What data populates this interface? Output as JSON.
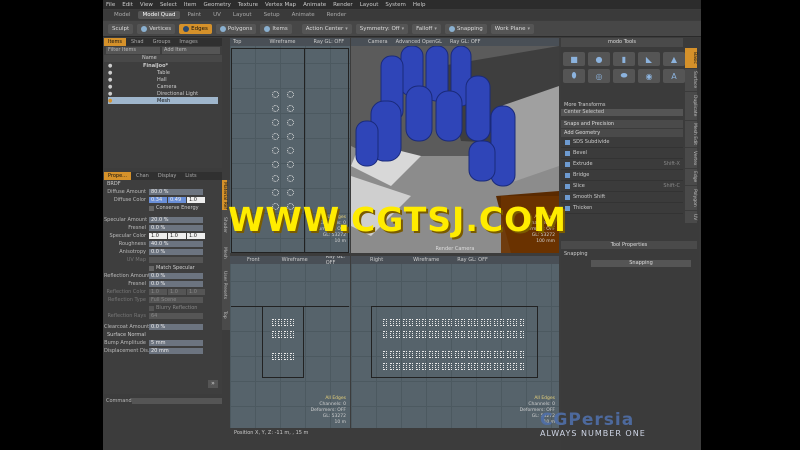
{
  "menu": [
    "File",
    "Edit",
    "View",
    "Select",
    "Item",
    "Geometry",
    "Texture",
    "Vertex Map",
    "Animate",
    "Render",
    "Layout",
    "System",
    "Help"
  ],
  "layout_tabs": [
    {
      "label": "Model",
      "active": false
    },
    {
      "label": "Model Quad",
      "active": true
    },
    {
      "label": "Paint",
      "active": false
    },
    {
      "label": "UV",
      "active": false
    },
    {
      "label": "Layout",
      "active": false
    },
    {
      "label": "Setup",
      "active": false
    },
    {
      "label": "Animate",
      "active": false
    },
    {
      "label": "Render",
      "active": false
    }
  ],
  "toolbar": {
    "sculpt": "Sculpt",
    "vertices": "Vertices",
    "edges": "Edges",
    "polygons": "Polygons",
    "items": "Items",
    "action_center": "Action Center",
    "symmetry": "Symmetry: Off",
    "falloff": "Falloff",
    "snapping": "Snapping",
    "work_plane": "Work Plane"
  },
  "item_list": {
    "tabs": [
      "Items",
      "Shad",
      "Groups",
      "Images"
    ],
    "filter": "Filter Items",
    "add_item": "Add Item",
    "name_header": "Name",
    "items": [
      "FinalJoo*",
      "Table",
      "Hall",
      "Camera",
      "Directional Light",
      "Mesh"
    ]
  },
  "props": {
    "tabs": [
      "Prope...",
      "Chan",
      "Display",
      "Lists"
    ],
    "section": "BRDF",
    "diffuse_amount": {
      "label": "Diffuse Amount",
      "value": "80.0 %"
    },
    "diffuse_color": {
      "label": "Diffuse Color",
      "r": "0.34",
      "g": "0.49",
      "b": "1.0"
    },
    "conserve_energy": "Conserve Energy",
    "specular_amount": {
      "label": "Specular Amount",
      "value": "20.0 %"
    },
    "fresnel": {
      "label": "Fresnel",
      "value": "0.0 %"
    },
    "specular_color": {
      "label": "Specular Color",
      "r": "1.0",
      "g": "1.0",
      "b": "1.0"
    },
    "roughness": {
      "label": "Roughness",
      "value": "40.0 %"
    },
    "anisotropy": {
      "label": "Anisotropy",
      "value": "0.0 %"
    },
    "uv_map": {
      "label": "UV Map",
      "value": ""
    },
    "match_specular": "Match Specular",
    "reflection_amount": {
      "label": "Reflection Amount",
      "value": "0.0 %"
    },
    "fresnel2": {
      "label": "Fresnel",
      "value": "0.0 %"
    },
    "reflection_color": {
      "label": "Reflection Color",
      "r": "1.0",
      "g": "1.0",
      "b": "1.0"
    },
    "reflection_type": {
      "label": "Reflection Type",
      "value": "Full Scene"
    },
    "blurry_reflection": "Blurry Reflection",
    "reflection_rays": {
      "label": "Reflection Rays",
      "value": "64"
    },
    "clearcoat_amount": {
      "label": "Clearcoat Amount",
      "value": "0.0 %"
    },
    "surface_normal": "Surface Normal",
    "bump_amplitude": {
      "label": "Bump Amplitude",
      "value": "5 mm"
    },
    "displacement": {
      "label": "Displacement Dis...",
      "value": "20 mm"
    },
    "side_tabs": [
      "Material Ref",
      "Shader",
      "Mesh",
      "User Presets",
      "Top"
    ]
  },
  "command": {
    "label": "Command"
  },
  "viewports": {
    "top": {
      "name": "Top",
      "mode": "Wireframe",
      "gl": "Ray GL: OFF",
      "info1": "All Edges",
      "info2": "Channels: 0",
      "info3": "Deformers: OFF",
      "info4": "GL: 53272",
      "info5": "10 m"
    },
    "camera": {
      "name": "Camera",
      "mode": "Advanced OpenGL",
      "gl": "Ray GL: OFF",
      "info1": "All Edges",
      "info2": "Channels: 0",
      "info3": "Deformers: OFF",
      "info4": "GL: 53272",
      "info5": "100 mm",
      "footer": "Render Camera"
    },
    "front": {
      "name": "Front",
      "mode": "Wireframe",
      "gl": "Ray GL: OFF",
      "info1": "All Edges",
      "info2": "Channels: 0",
      "info3": "Deformers: OFF",
      "info4": "GL: 53272",
      "info5": "10 m"
    },
    "right": {
      "name": "Right",
      "mode": "Wireframe",
      "gl": "Ray GL: OFF",
      "info1": "All Edges",
      "info2": "Channels: 0",
      "info3": "Deformers: OFF",
      "info4": "GL: 53272",
      "info5": "10 m"
    }
  },
  "status": {
    "position": "Position X, Y, Z:   -11 m, , 15 m"
  },
  "tools": {
    "title": "modo Tools",
    "more_transforms": "More Transforms",
    "center_selected": "Center Selected",
    "snaps": "Snaps and Precision",
    "add_geometry": "Add Geometry",
    "items": [
      {
        "label": "SDS Subdivide",
        "shortcut": ""
      },
      {
        "label": "Bevel",
        "shortcut": ""
      },
      {
        "label": "Extrude",
        "shortcut": "Shift-X"
      },
      {
        "label": "Bridge",
        "shortcut": ""
      },
      {
        "label": "Slice",
        "shortcut": "Shift-C"
      },
      {
        "label": "Smooth Shift",
        "shortcut": ""
      },
      {
        "label": "Thicken",
        "shortcut": ""
      }
    ],
    "tool_properties": "Tool Properties",
    "snapping": "Snapping",
    "snapping_btn": "Snapping",
    "side_tabs": [
      "Basic",
      "Surface",
      "Duplicate",
      "Mesh Edit",
      "Vertex",
      "Edge",
      "Polygon",
      "UV"
    ]
  },
  "watermark": "WWW.CGTSJ.COM",
  "cgpersia": {
    "title": "CGPersia",
    "tagline": "ALWAYS NUMBER ONE"
  }
}
